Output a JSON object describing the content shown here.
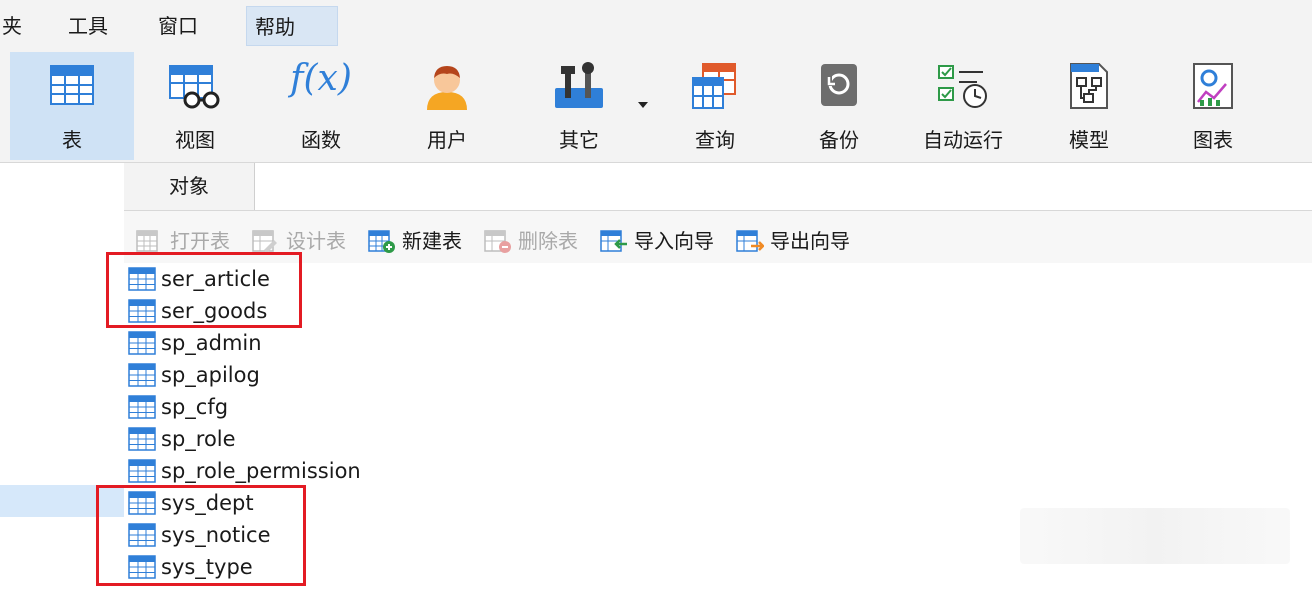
{
  "menu": {
    "items": [
      {
        "label": "夹"
      },
      {
        "label": "工具"
      },
      {
        "label": "窗口"
      },
      {
        "label": "帮助"
      }
    ]
  },
  "ribbon": {
    "buttons": [
      {
        "label": "表",
        "icon": "table-icon"
      },
      {
        "label": "视图",
        "icon": "view-icon"
      },
      {
        "label": "函数",
        "icon": "function-icon"
      },
      {
        "label": "用户",
        "icon": "user-icon"
      },
      {
        "label": "其它",
        "icon": "tools-icon"
      },
      {
        "label": "查询",
        "icon": "query-icon"
      },
      {
        "label": "备份",
        "icon": "backup-icon"
      },
      {
        "label": "自动运行",
        "icon": "auto-run-icon"
      },
      {
        "label": "模型",
        "icon": "model-icon"
      },
      {
        "label": "图表",
        "icon": "chart-icon"
      }
    ],
    "function_symbol": "f(x)"
  },
  "tabs": {
    "objects": "对象"
  },
  "object_toolbar": {
    "open_table": "打开表",
    "design_table": "设计表",
    "new_table": "新建表",
    "delete_table": "删除表",
    "import_wizard": "导入向导",
    "export_wizard": "导出向导"
  },
  "tables": [
    "ser_article",
    "ser_goods",
    "sp_admin",
    "sp_apilog",
    "sp_cfg",
    "sp_role",
    "sp_role_permission",
    "sys_dept",
    "sys_notice",
    "sys_type"
  ],
  "colors": {
    "highlight": "#e31b23",
    "accent": "#2f7fd8",
    "selected": "#cfe2f5"
  }
}
